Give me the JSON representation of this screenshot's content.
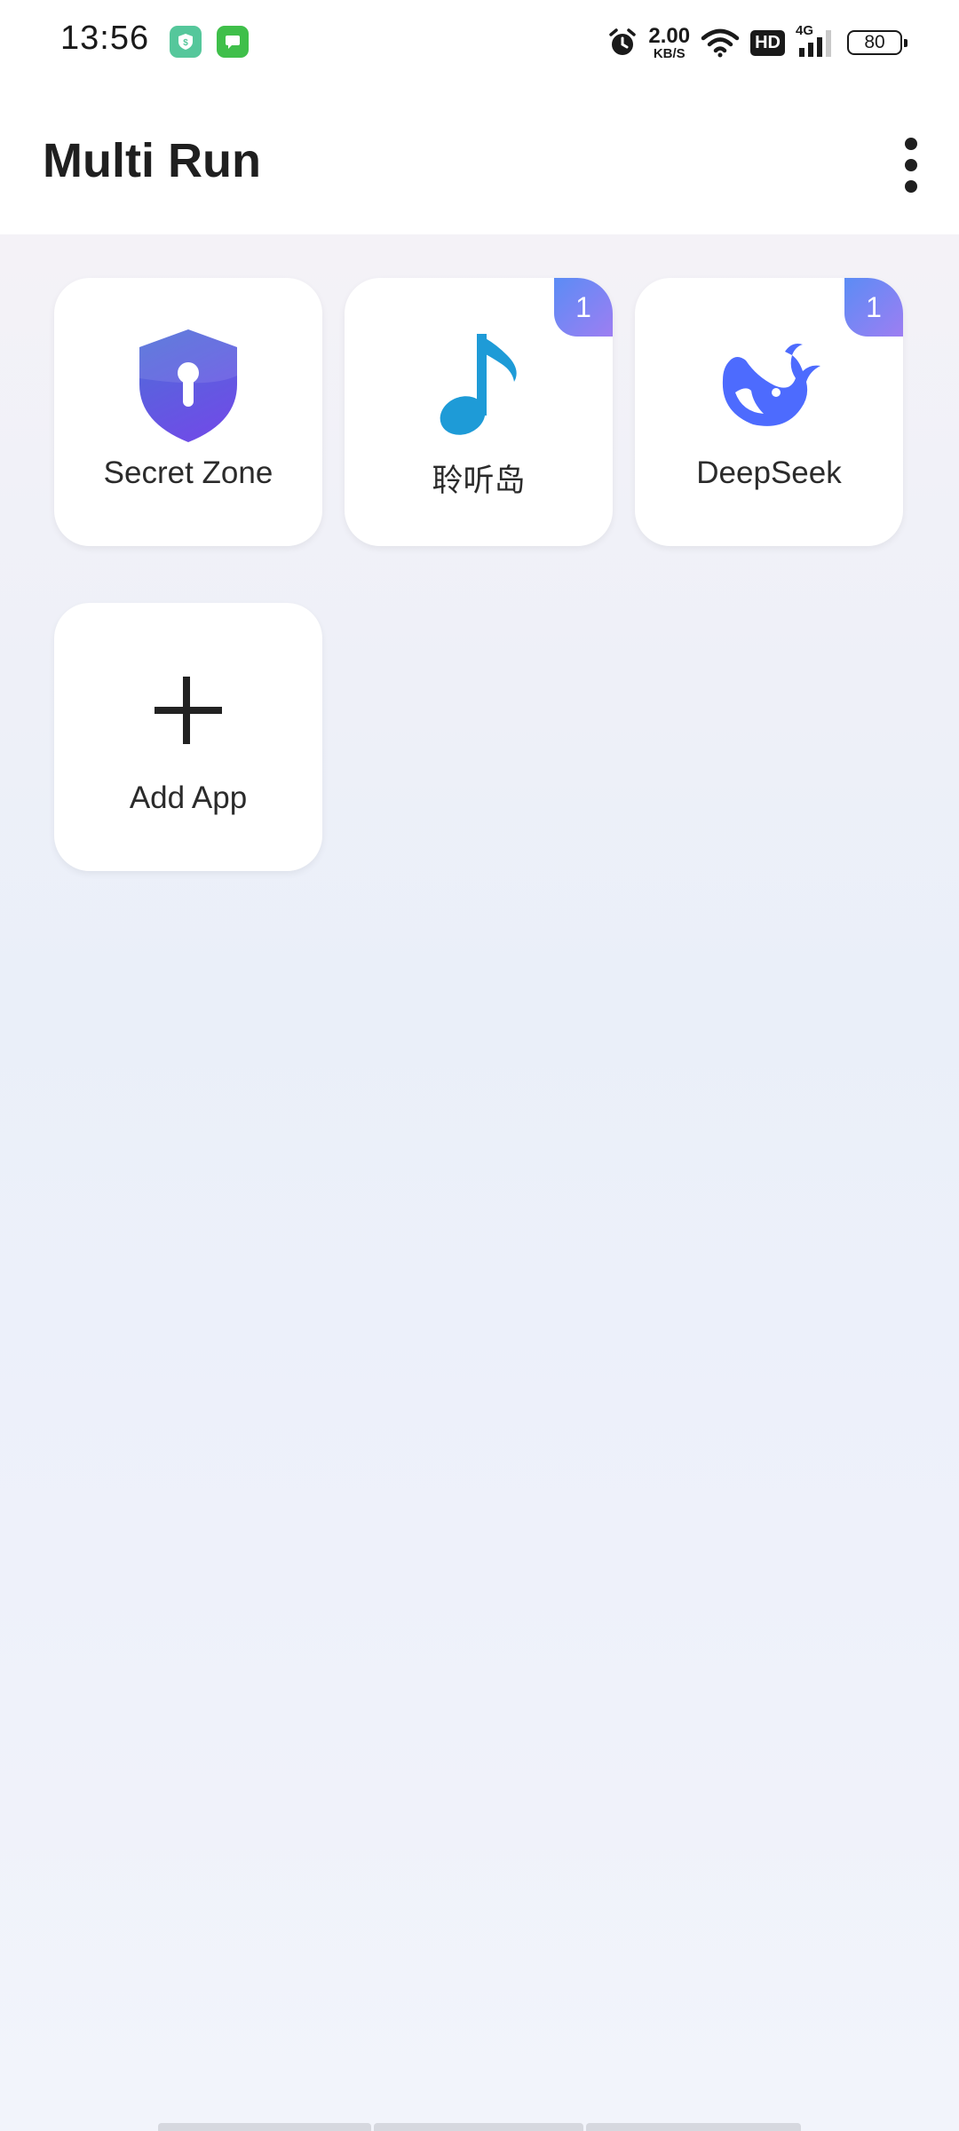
{
  "status_bar": {
    "time": "13:56",
    "net_speed_value": "2.00",
    "net_speed_unit": "KB/S",
    "hd_label": "HD",
    "network_type": "4G",
    "battery": "80",
    "icons": [
      "app-notification-icon",
      "message-notification-icon",
      "alarm-icon",
      "wifi-icon",
      "signal-icon",
      "battery-icon"
    ]
  },
  "app_bar": {
    "title": "Multi Run",
    "menu_icon": "more-vert-icon"
  },
  "apps": [
    {
      "name": "Secret Zone",
      "icon": "shield-lock-icon",
      "badge": ""
    },
    {
      "name": "聆听岛",
      "icon": "music-note-icon",
      "badge": "1"
    },
    {
      "name": "DeepSeek",
      "icon": "whale-icon",
      "badge": "1"
    },
    {
      "name": "Add App",
      "icon": "plus-icon",
      "badge": ""
    }
  ],
  "colors": {
    "badge_start": "#5b8cf5",
    "badge_end": "#9d7ef2",
    "shield": "#5a5fe0",
    "music_note": "#1e9bd7",
    "deepseek": "#4d6bfe"
  }
}
